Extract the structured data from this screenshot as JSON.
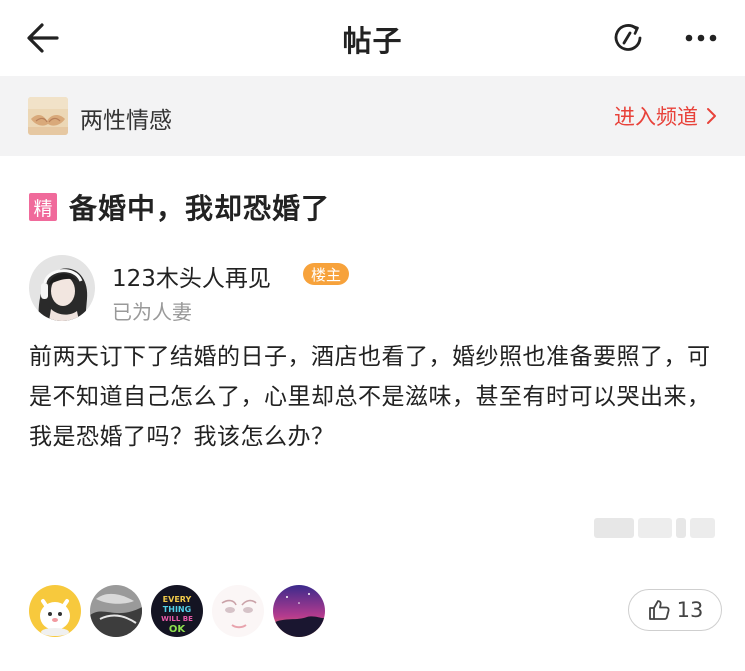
{
  "header": {
    "title": "帖子",
    "back_icon": "back-arrow-icon",
    "refresh_icon": "refresh-icon",
    "more_icon": "more-dots-icon"
  },
  "channel": {
    "name": "两性情感",
    "enter_label": "进入频道",
    "accent_color": "#e8423a"
  },
  "post": {
    "badge": "精",
    "title": "备婚中，我却恐婚了",
    "author": {
      "name": "123木头人再见",
      "badge": "楼主",
      "status": "已为人妻"
    },
    "body": "前两天订下了结婚的日子，酒店也看了，婚纱照也准备要照了，可是不知道自己怎么了，心里却总不是滋味，甚至有时可以哭出来，我是恐婚了吗？我该怎么办？"
  },
  "footer": {
    "liker_count_shown": 5,
    "like_count": "13",
    "like_icon": "thumbs-up-icon",
    "liker3_text": "EVERY THING WILL BE OK"
  }
}
